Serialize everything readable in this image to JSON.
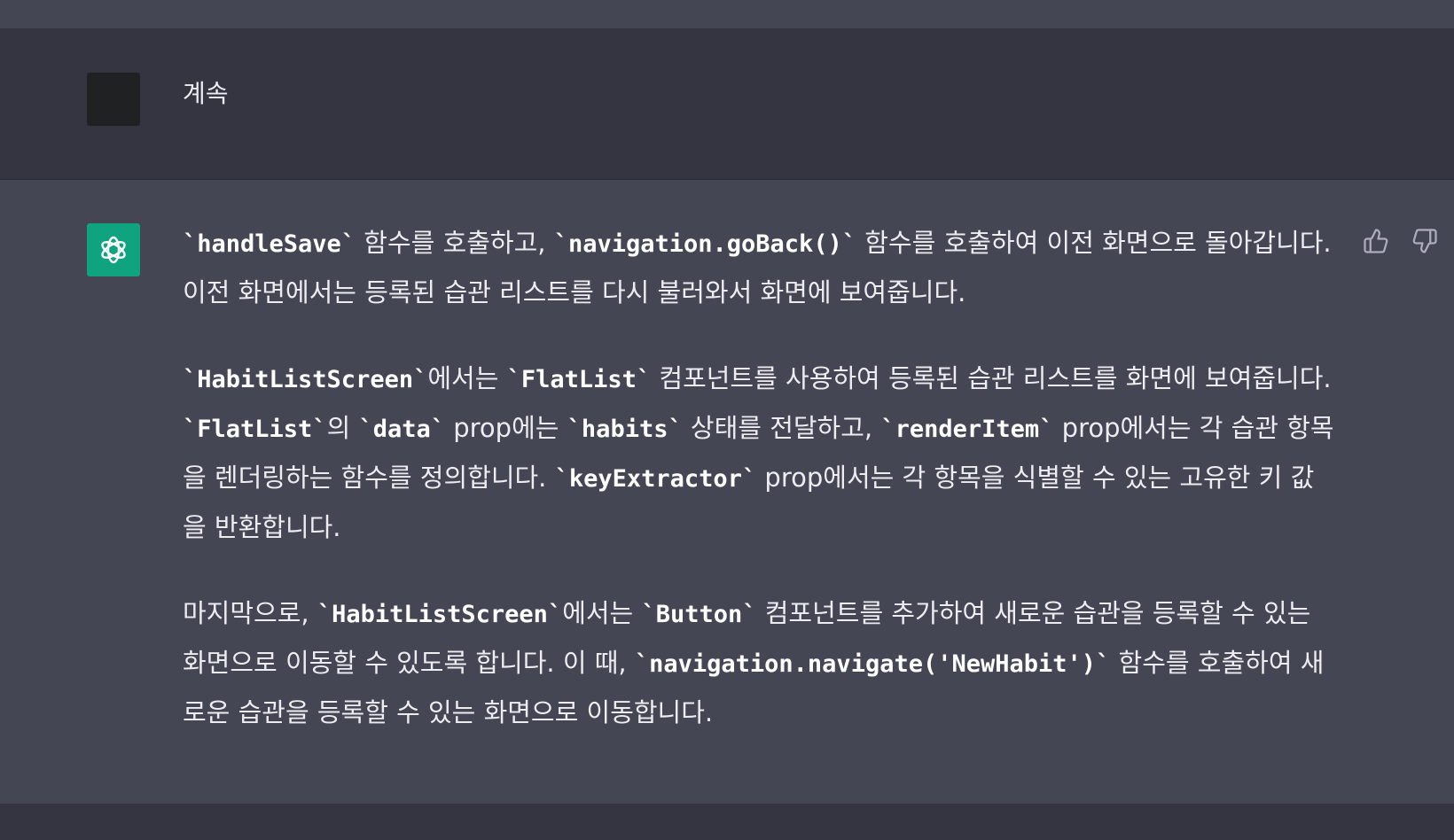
{
  "user_message": {
    "text": "계속"
  },
  "assistant_message": {
    "paragraphs": [
      [
        {
          "t": "`handleSave`",
          "code": true
        },
        {
          "t": " 함수를 호출하고, "
        },
        {
          "t": "`navigation.goBack()`",
          "code": true
        },
        {
          "t": " 함수를 호출하여 이전 화면으로 돌아갑니다. 이전 화면에서는 등록된 습관 리스트를 다시 불러와서 화면에 보여줍니다."
        }
      ],
      [
        {
          "t": "`HabitListScreen`",
          "code": true
        },
        {
          "t": "에서는 "
        },
        {
          "t": "`FlatList`",
          "code": true
        },
        {
          "t": " 컴포넌트를 사용하여 등록된 습관 리스트를 화면에 보여줍니다. "
        },
        {
          "t": "`FlatList`",
          "code": true
        },
        {
          "t": "의 "
        },
        {
          "t": "`data`",
          "code": true
        },
        {
          "t": " prop에는 "
        },
        {
          "t": "`habits`",
          "code": true
        },
        {
          "t": " 상태를 전달하고, "
        },
        {
          "t": "`renderItem`",
          "code": true
        },
        {
          "t": " prop에서는 각 습관 항목을 렌더링하는 함수를 정의합니다. "
        },
        {
          "t": "`keyExtractor`",
          "code": true
        },
        {
          "t": " prop에서는 각 항목을 식별할 수 있는 고유한 키 값을 반환합니다."
        }
      ],
      [
        {
          "t": "마지막으로, "
        },
        {
          "t": "`HabitListScreen`",
          "code": true
        },
        {
          "t": "에서는 "
        },
        {
          "t": "`Button`",
          "code": true
        },
        {
          "t": " 컴포넌트를 추가하여 새로운 습관을 등록할 수 있는 화면으로 이동할 수 있도록 합니다. 이 때, "
        },
        {
          "t": "`navigation.navigate('NewHabit')`",
          "code": true
        },
        {
          "t": " 함수를 호출하여 새로운 습관을 등록할 수 있는 화면으로 이동합니다."
        }
      ]
    ]
  },
  "icons": {
    "assistant_avatar": "openai-logo-icon",
    "thumbs_up": "thumbs-up-icon",
    "thumbs_down": "thumbs-down-icon"
  },
  "colors": {
    "user_bg": "#343541",
    "assistant_bg": "#444654",
    "avatar_green": "#10a37f",
    "text": "#ececf1"
  }
}
